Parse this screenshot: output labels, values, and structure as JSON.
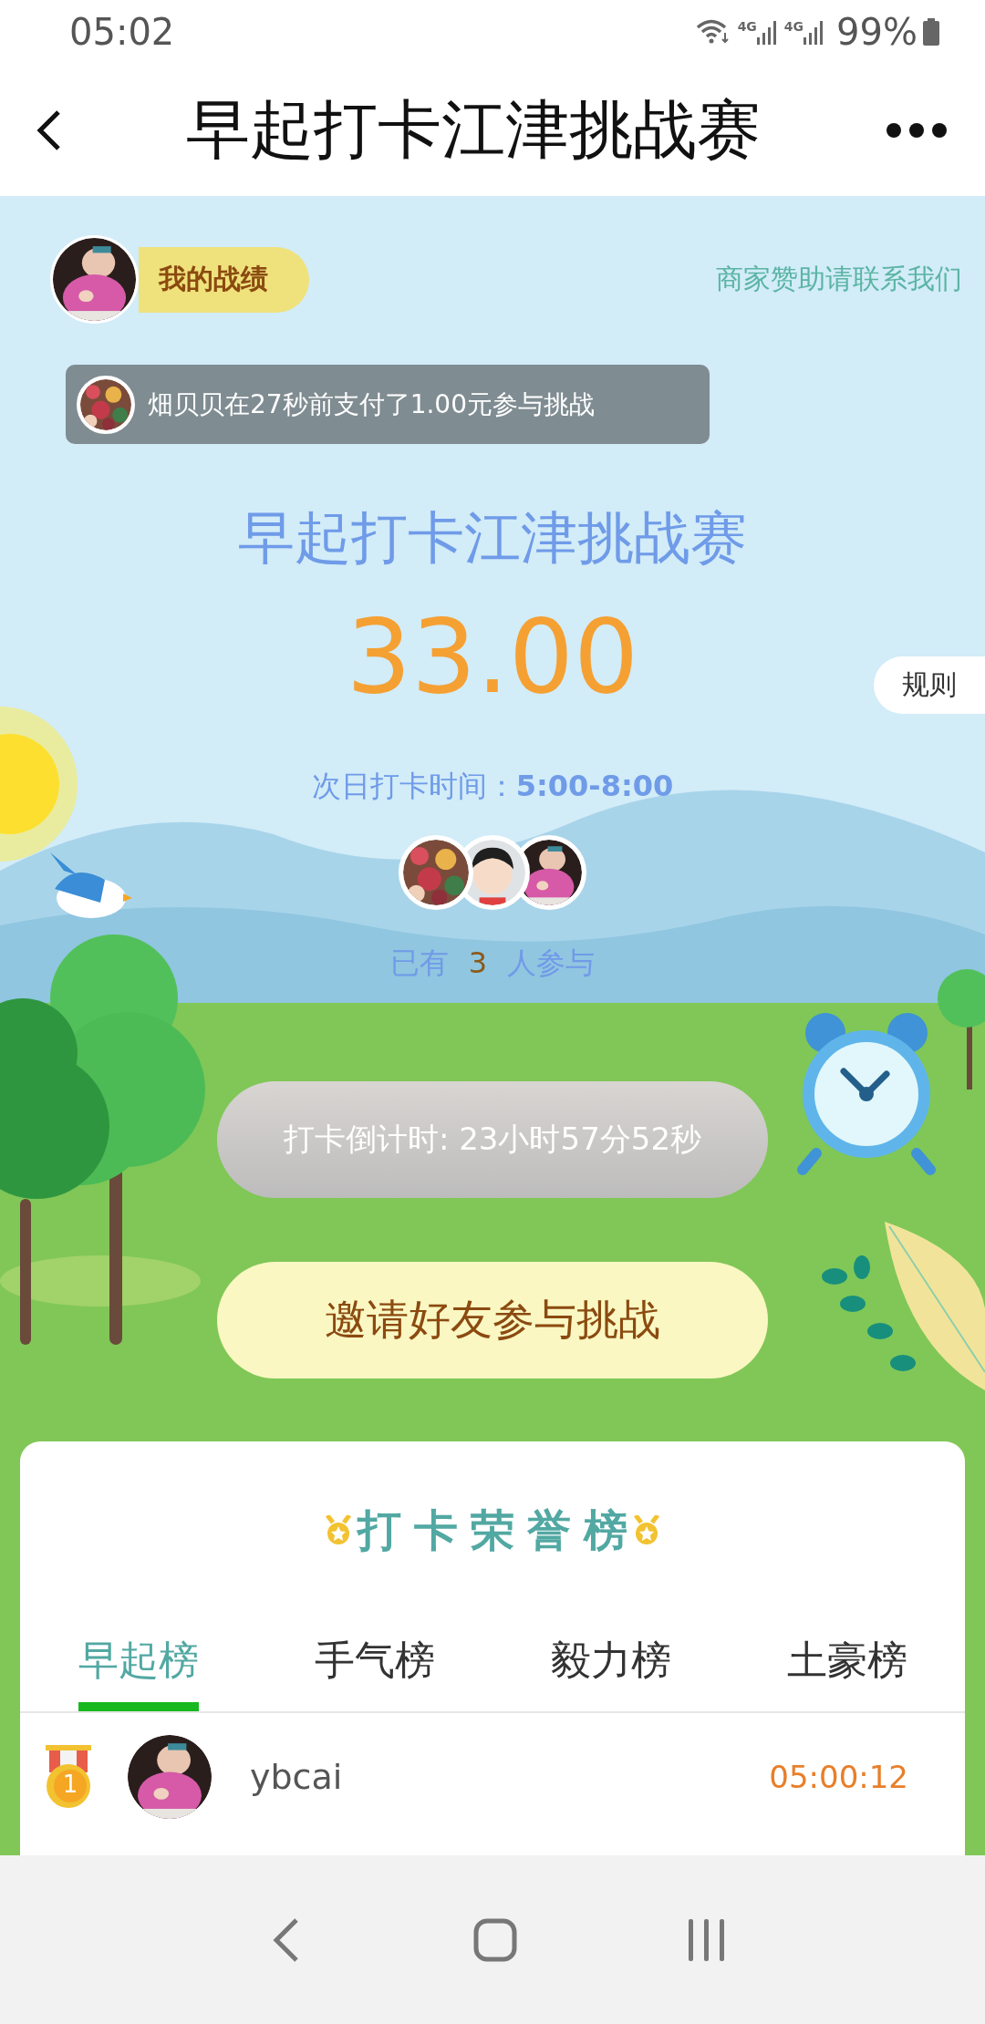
{
  "status_bar": {
    "time": "05:02",
    "signals": [
      "4G",
      "4G"
    ],
    "battery": "99%"
  },
  "header": {
    "title": "早起打卡江津挑战赛"
  },
  "my_record": {
    "label": "我的战绩"
  },
  "sponsor_link": "商家赞助请联系我们",
  "notification": {
    "text": "畑贝贝在27秒前支付了1.00元参与挑战"
  },
  "challenge": {
    "title": "早起打卡江津挑战赛",
    "pool": "33.00",
    "rules_tab": "规则",
    "checkin_time_label": "次日打卡时间：",
    "checkin_time": "5:00-8:00",
    "count_prefix": "已有",
    "count": "3",
    "count_suffix": "人参与"
  },
  "countdown_button": "打卡倒计时: 23小时57分52秒",
  "invite_button": "邀请好友参与挑战",
  "leaderboard": {
    "title": "打卡荣誉榜",
    "tabs": [
      {
        "label": "早起榜",
        "selected": true
      },
      {
        "label": "手气榜",
        "selected": false
      },
      {
        "label": "毅力榜",
        "selected": false
      },
      {
        "label": "土豪榜",
        "selected": false
      }
    ],
    "rows": [
      {
        "rank": "1",
        "name": "ybcai",
        "time": "05:00:12"
      }
    ]
  }
}
